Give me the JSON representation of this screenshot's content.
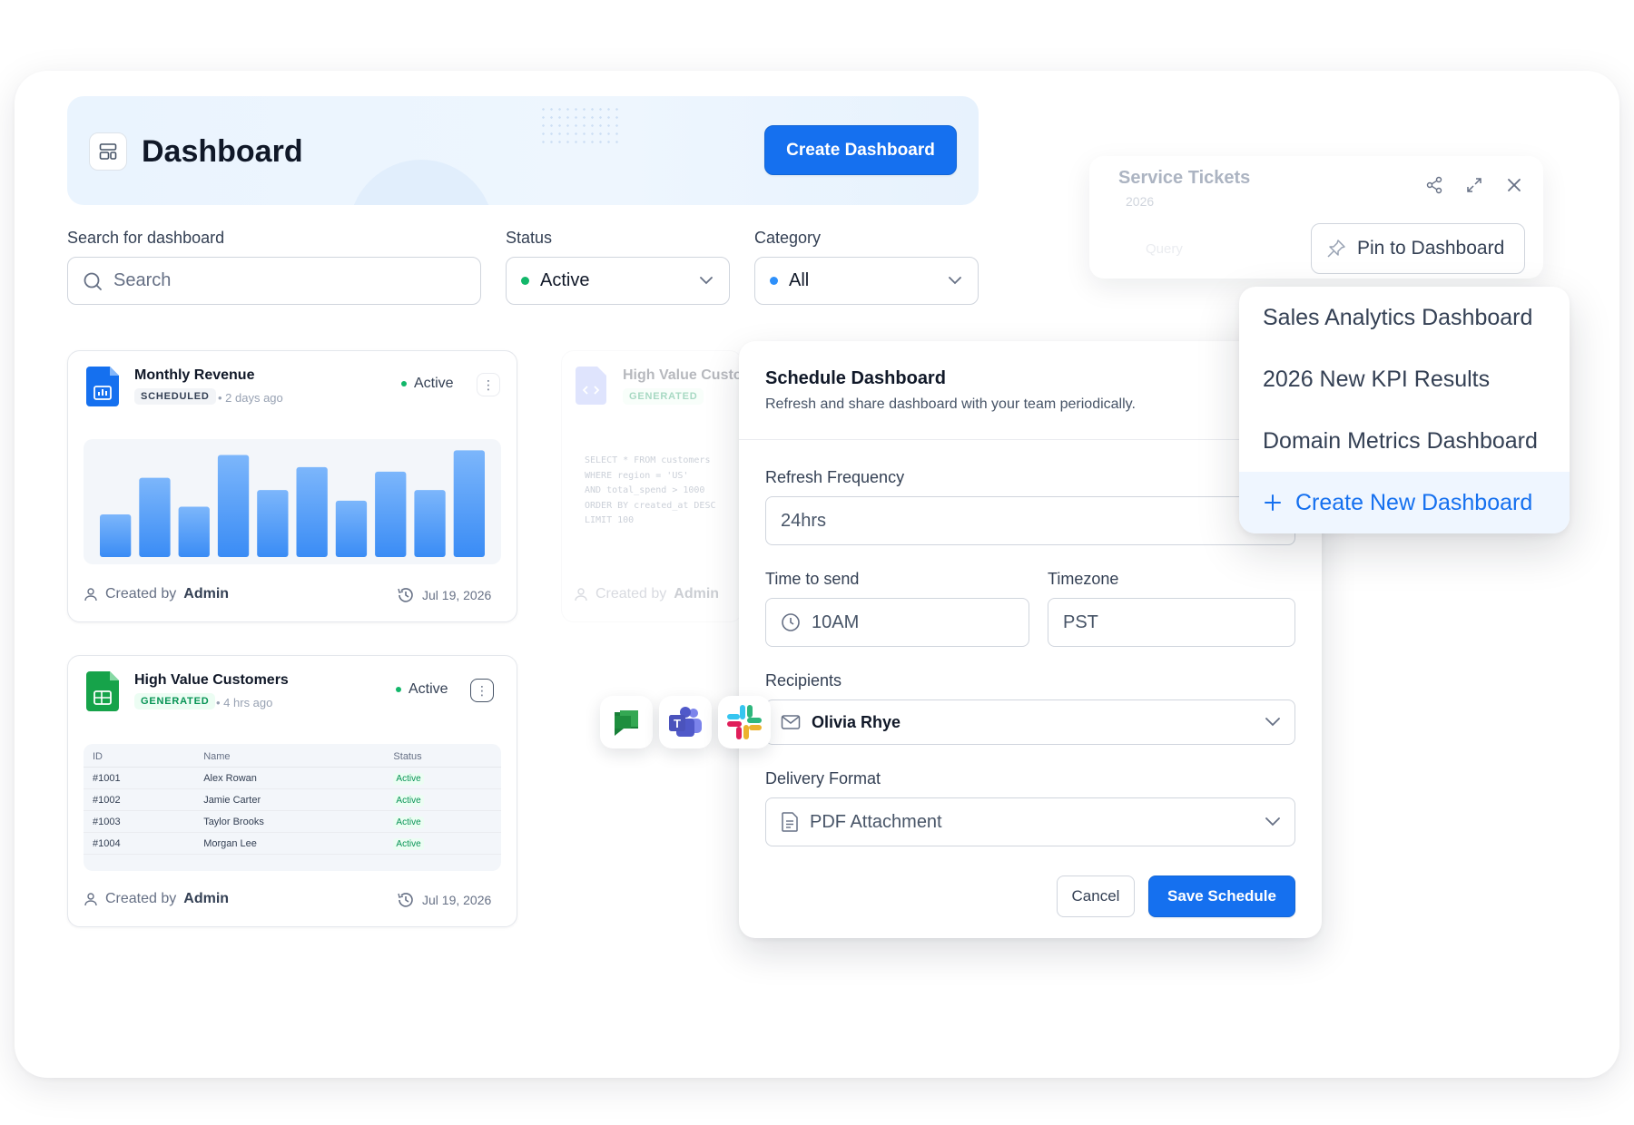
{
  "header": {
    "title": "Dashboard",
    "create_button": "Create Dashboard"
  },
  "filters": {
    "search_label": "Search for dashboard",
    "search_placeholder": "Search",
    "status_label": "Status",
    "status_value": "Active",
    "category_label": "Category",
    "category_value": "All"
  },
  "cards": [
    {
      "title": "Monthly Revenue",
      "tag": "SCHEDULED",
      "time": "• 2 days ago",
      "status": "Active",
      "created_by_label": "Created by",
      "created_by": "Admin",
      "date": "Jul 19, 2026",
      "chart_data": {
        "type": "bar",
        "values": [
          28,
          52,
          33,
          67,
          44,
          59,
          37,
          56,
          44,
          70
        ],
        "ylim": [
          0,
          75
        ],
        "grid": false
      }
    },
    {
      "title": "High Value Customers",
      "tag": "GENERATED",
      "time": "• 4 hrs ago",
      "status": "Active",
      "created_by_label": "Created by",
      "created_by": "Admin",
      "date": "Jul 19, 2026",
      "table": {
        "columns": [
          "ID",
          "Name",
          "Status"
        ],
        "rows": [
          [
            "#1001",
            "Alex Rowan",
            "Active"
          ],
          [
            "#1002",
            "Jamie Carter",
            "Active"
          ],
          [
            "#1003",
            "Taylor Brooks",
            "Active"
          ],
          [
            "#1004",
            "Morgan Lee",
            "Active"
          ]
        ]
      }
    }
  ],
  "ghost_card": {
    "title": "High Value Custo",
    "tag": "GENERATED",
    "sql": [
      "SELECT * FROM customers",
      "WHERE region = 'US'",
      "AND total_spend > 1000",
      "ORDER BY created_at DESC",
      "LIMIT 100"
    ],
    "created_by_label": "Created by",
    "created_by": "Admin"
  },
  "ghost_panel": {
    "title": "Service Tickets",
    "sub": "2026",
    "query": "Query",
    "pin_button": "Pin to Dashboard"
  },
  "dropdown": {
    "items": [
      "Sales Analytics Dashboard",
      "2026 New KPI Results",
      "Domain Metrics Dashboard"
    ],
    "create_item": "Create New Dashboard"
  },
  "schedule": {
    "title": "Schedule Dashboard",
    "subtitle": "Refresh and share dashboard with your team periodically.",
    "refresh_label": "Refresh Frequency",
    "refresh_value": "24hrs",
    "time_label": "Time to send",
    "time_value": "10AM",
    "timezone_label": "Timezone",
    "timezone_value": "PST",
    "recipients_label": "Recipients",
    "recipients_value": "Olivia Rhye",
    "format_label": "Delivery Format",
    "format_value": "PDF Attachment",
    "cancel_button": "Cancel",
    "save_button": "Save Schedule"
  },
  "integrations": [
    "google-chat-icon",
    "microsoft-teams-icon",
    "slack-icon"
  ],
  "colors": {
    "primary": "#1570ef",
    "active_green": "#12b76a",
    "category_blue": "#2e90fa",
    "sheet_green": "#16a34a"
  }
}
